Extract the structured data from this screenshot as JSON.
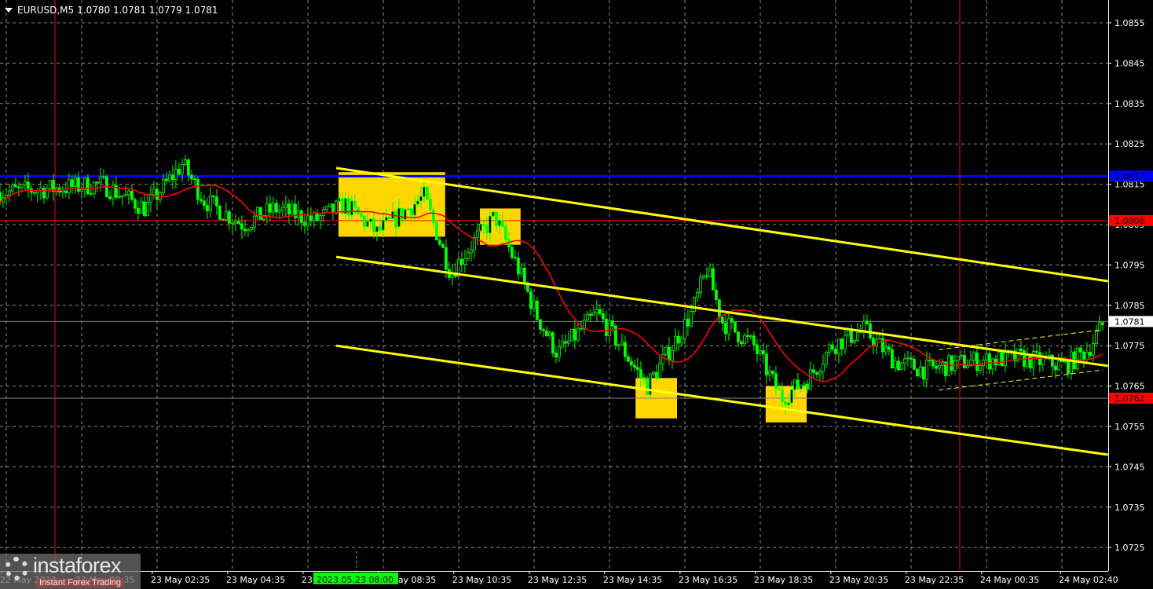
{
  "header": {
    "symbol": "EURUSD,M5",
    "ohlc": "1.0780 1.0781 1.0779 1.0781"
  },
  "logo": {
    "brand": "instaforex",
    "tagline": "Instant Forex Trading"
  },
  "colors": {
    "background": "#000000",
    "candle": "#00ff00",
    "ma": "#ff0000",
    "channel": "#ffff00",
    "box": "#ffd700",
    "level_blue": "#0000ff",
    "level_red": "#ff0000",
    "grid": "#8a8a8a",
    "axis_text": "#ffffff",
    "time_marker": "#00ff00"
  },
  "chart_data": {
    "type": "candlestick",
    "title": "EURUSD, M5",
    "time_unit": "hours since 23 May 00:00",
    "bar_minutes": 5,
    "ylim": [
      1.072,
      1.086
    ],
    "xlim": [
      -1.46,
      28.0
    ],
    "y_ticks": [
      "1.0855",
      "1.0845",
      "1.0835",
      "1.0825",
      "1.0815",
      "1.0805",
      "1.0795",
      "1.0785",
      "1.0775",
      "1.0765",
      "1.0755",
      "1.0745",
      "1.0735",
      "1.0725"
    ],
    "x_ticks": [
      {
        "t": -1.42,
        "label": "22 May 2023"
      },
      {
        "t": 0.58,
        "label": "23 May 00:35"
      },
      {
        "t": 2.58,
        "label": "23 May 02:35"
      },
      {
        "t": 4.58,
        "label": "23 May 04:35"
      },
      {
        "t": 6.58,
        "label": "23 May 06:35"
      },
      {
        "t": 8.58,
        "label": "23 May 08:35"
      },
      {
        "t": 10.58,
        "label": "23 May 10:35"
      },
      {
        "t": 12.58,
        "label": "23 May 12:35"
      },
      {
        "t": 14.58,
        "label": "23 May 14:35"
      },
      {
        "t": 16.58,
        "label": "23 May 16:35"
      },
      {
        "t": 18.58,
        "label": "23 May 18:35"
      },
      {
        "t": 20.58,
        "label": "23 May 20:35"
      },
      {
        "t": 22.58,
        "label": "23 May 22:35"
      },
      {
        "t": 24.58,
        "label": "24 May 00:35"
      },
      {
        "t": 26.67,
        "label": "24 May 02:40"
      }
    ],
    "crosshair_time": {
      "t": 8.0,
      "label": "2023.05.23 08:00"
    },
    "price_path": [
      [
        -1.46,
        1.0813
      ],
      [
        0,
        1.0814
      ],
      [
        1.25,
        1.0815
      ],
      [
        2.4,
        1.0809
      ],
      [
        3.38,
        1.082
      ],
      [
        3.96,
        1.0811
      ],
      [
        5.0,
        1.0805
      ],
      [
        5.83,
        1.0809
      ],
      [
        6.88,
        1.0806
      ],
      [
        7.7,
        1.081
      ],
      [
        8.54,
        1.0803
      ],
      [
        9.79,
        1.0812
      ],
      [
        10.5,
        1.0793
      ],
      [
        11.04,
        1.08
      ],
      [
        11.67,
        1.0807
      ],
      [
        12.29,
        1.0794
      ],
      [
        12.8,
        1.0782
      ],
      [
        13.33,
        1.0773
      ],
      [
        14.38,
        1.0783
      ],
      [
        15.0,
        1.0775
      ],
      [
        15.7,
        1.0765
      ],
      [
        16.25,
        1.0773
      ],
      [
        16.88,
        1.0783
      ],
      [
        17.3,
        1.0794
      ],
      [
        17.7,
        1.0781
      ],
      [
        18.54,
        1.0775
      ],
      [
        19.27,
        1.0762
      ],
      [
        20.0,
        1.0767
      ],
      [
        20.6,
        1.0775
      ],
      [
        21.46,
        1.0779
      ],
      [
        22.3,
        1.0771
      ],
      [
        23.1,
        1.0769
      ],
      [
        24.15,
        1.0771
      ],
      [
        25.6,
        1.0772
      ],
      [
        26.8,
        1.077
      ],
      [
        27.4,
        1.0774
      ],
      [
        27.85,
        1.0781
      ]
    ],
    "moving_average_period": 20,
    "levels": [
      {
        "price": 1.0817,
        "label": "1.0817",
        "color": "#0000ff",
        "text_color": "#000000",
        "width": 3
      },
      {
        "price": 1.0806,
        "label": "1.0806",
        "color": "#ff0000",
        "text_color": "#000000",
        "width": 1
      },
      {
        "price": 1.0781,
        "label": "1.0781",
        "color": "#ffffff",
        "text_color": "#000000",
        "width": 1,
        "line": "#808080"
      },
      {
        "price": 1.0762,
        "label": "1.0762",
        "color": "#ff0000",
        "text_color": "#000000",
        "width": 1,
        "line": "#808080"
      }
    ],
    "vertical_lines": [
      {
        "t": 0,
        "color": "#ff0000"
      },
      {
        "t": 24,
        "color": "#ff0000"
      }
    ],
    "channel_lines": [
      {
        "t1": 7.46,
        "p1": 1.0819,
        "t2": 27.93,
        "p2": 1.0791
      },
      {
        "t1": 7.46,
        "p1": 1.0797,
        "t2": 27.93,
        "p2": 1.077
      },
      {
        "t1": 7.46,
        "p1": 1.0775,
        "t2": 27.93,
        "p2": 1.0748
      }
    ],
    "dashed_channel": [
      {
        "t1": 23.44,
        "p1": 1.0774,
        "t2": 27.8,
        "p2": 1.0779
      },
      {
        "t1": 23.44,
        "p1": 1.0764,
        "t2": 27.8,
        "p2": 1.0769
      }
    ],
    "signal_boxes": [
      {
        "t1": 7.52,
        "t2": 10.35,
        "p_top": 1.0818,
        "p_bottom": 1.0802
      },
      {
        "t1": 11.27,
        "t2": 12.35,
        "p_top": 1.0809,
        "p_bottom": 1.08
      },
      {
        "t1": 15.4,
        "t2": 16.5,
        "p_top": 1.0767,
        "p_bottom": 1.0757
      },
      {
        "t1": 18.85,
        "t2": 19.94,
        "p_top": 1.0765,
        "p_bottom": 1.0756
      }
    ]
  }
}
